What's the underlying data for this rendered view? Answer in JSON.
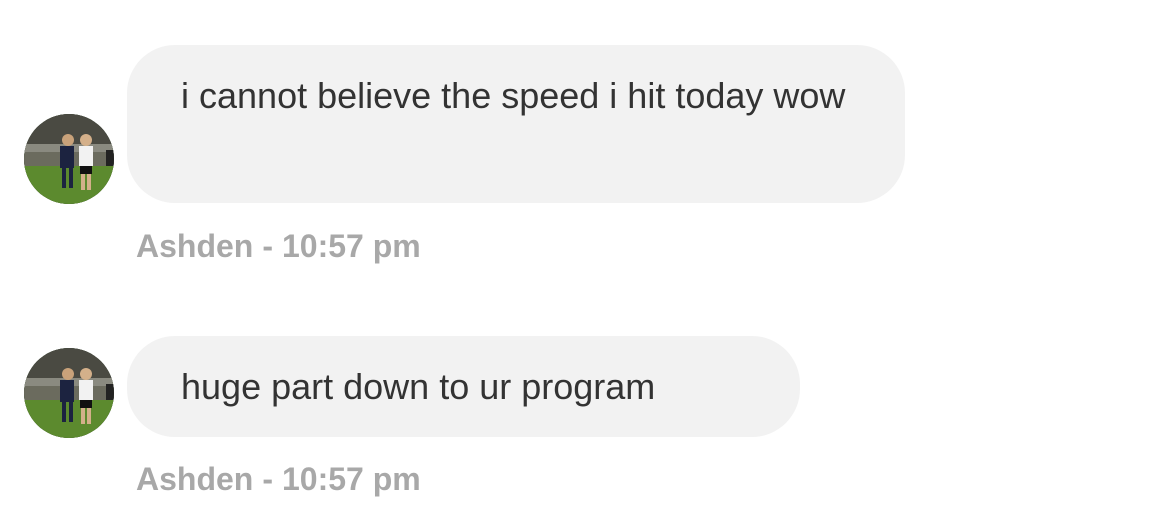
{
  "messages": [
    {
      "text": "i cannot believe the speed i hit today wow",
      "sender": "Ashden",
      "separator": "-",
      "time": "10:57 pm"
    },
    {
      "text": "huge part down to ur program",
      "sender": "Ashden",
      "separator": "-",
      "time": "10:57 pm"
    }
  ],
  "colors": {
    "bubble": "#f2f2f2",
    "text": "#333333",
    "meta": "#a8a8a8"
  },
  "icons": {
    "avatar": "sender-avatar-photo"
  }
}
